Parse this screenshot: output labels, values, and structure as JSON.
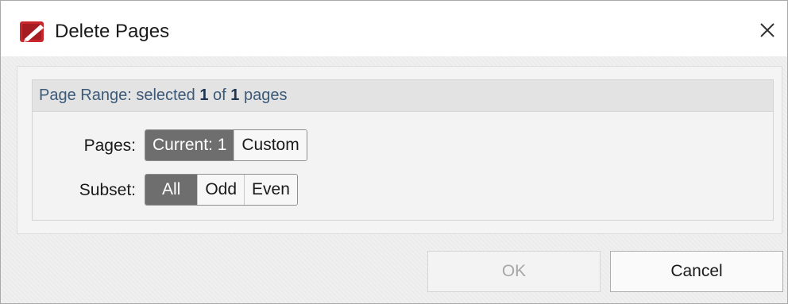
{
  "dialog": {
    "title": "Delete Pages",
    "icon": "pdf-editor-app-icon",
    "accent": "#c8262c"
  },
  "page_range": {
    "prefix": "Page Range: selected ",
    "selected": "1",
    "of": " of ",
    "total": "1",
    "suffix": " pages"
  },
  "pages_row": {
    "label": "Pages:",
    "options": [
      {
        "label": "Current: 1",
        "selected": true
      },
      {
        "label": "Custom",
        "selected": false
      }
    ]
  },
  "subset_row": {
    "label": "Subset:",
    "options": [
      {
        "label": "All",
        "selected": true
      },
      {
        "label": "Odd",
        "selected": false
      },
      {
        "label": "Even",
        "selected": false
      }
    ]
  },
  "buttons": {
    "ok": "OK",
    "ok_enabled": false,
    "cancel": "Cancel"
  }
}
